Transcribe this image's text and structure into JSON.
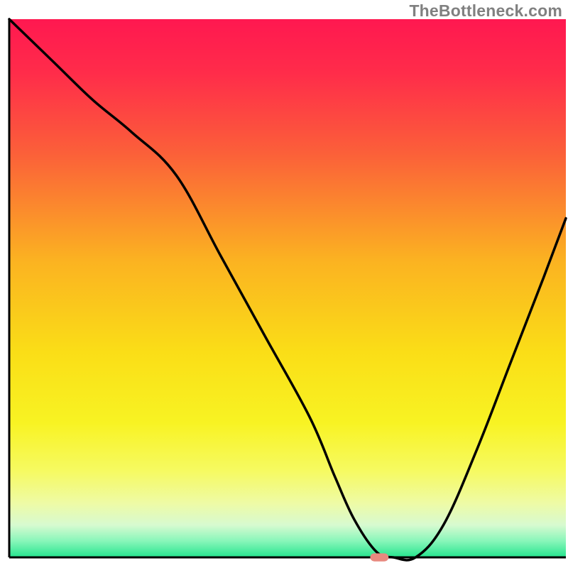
{
  "watermark": "TheBottleneck.com",
  "chart_data": {
    "type": "line",
    "title": "",
    "xlabel": "",
    "ylabel": "",
    "xlim": [
      0,
      100
    ],
    "ylim": [
      0,
      100
    ],
    "axes": {
      "top": false,
      "right": false,
      "bottom": true,
      "left": true
    },
    "background": {
      "type": "gradient",
      "stops": [
        {
          "pos": 0.0,
          "color": "#ff1850"
        },
        {
          "pos": 0.1,
          "color": "#ff2c4a"
        },
        {
          "pos": 0.25,
          "color": "#fb6039"
        },
        {
          "pos": 0.45,
          "color": "#fbb321"
        },
        {
          "pos": 0.62,
          "color": "#fade17"
        },
        {
          "pos": 0.75,
          "color": "#f8f323"
        },
        {
          "pos": 0.84,
          "color": "#f6fa62"
        },
        {
          "pos": 0.9,
          "color": "#eefba6"
        },
        {
          "pos": 0.94,
          "color": "#d7fad0"
        },
        {
          "pos": 0.97,
          "color": "#87f6b9"
        },
        {
          "pos": 1.0,
          "color": "#25e48e"
        }
      ]
    },
    "series": [
      {
        "name": "bottleneck-curve",
        "color": "#000000",
        "x": [
          0,
          8,
          15,
          22,
          30,
          38,
          46,
          54,
          58.5,
          62,
          66,
          69,
          73,
          78,
          84,
          90,
          96,
          100
        ],
        "y": [
          100,
          92,
          85,
          79,
          71,
          56,
          41,
          26,
          15,
          7,
          1,
          0,
          0,
          6,
          20,
          36,
          52,
          63
        ]
      }
    ],
    "marker": {
      "name": "optimal-point",
      "x": 66.5,
      "y": 0,
      "color": "#e8897f",
      "shape": "rounded-rect",
      "w": 3.3,
      "h": 1.5
    }
  }
}
